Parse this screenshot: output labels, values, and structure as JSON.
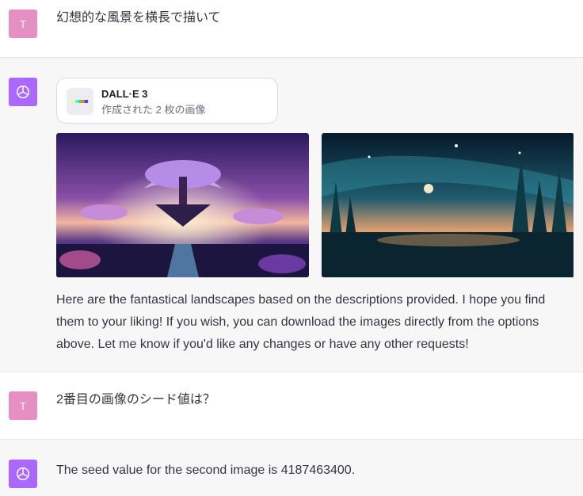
{
  "messages": {
    "m1": {
      "avatar": "T",
      "text": "幻想的な風景を横長で描いて"
    },
    "m2": {
      "tool": {
        "name": "DALL·E 3",
        "subtitle": "作成された 2 枚の画像"
      },
      "images": [
        {
          "alt": "floating islands with glowing tree at sunset"
        },
        {
          "alt": "crystal spires under starry night sky"
        }
      ],
      "text": "Here are the fantastical landscapes based on the descriptions provided. I hope you find them to your liking! If you wish, you can download the images directly from the options above. Let me know if you'd like any changes or have any other requests!"
    },
    "m3": {
      "avatar": "T",
      "text": "2番目の画像のシード値は？"
    },
    "m4": {
      "text": "The seed value for the second image is 4187463400."
    }
  },
  "colors": {
    "user_avatar": "#e58fc2",
    "bot_avatar": "#ab68ff",
    "bot_bg": "#f7f7f8"
  }
}
